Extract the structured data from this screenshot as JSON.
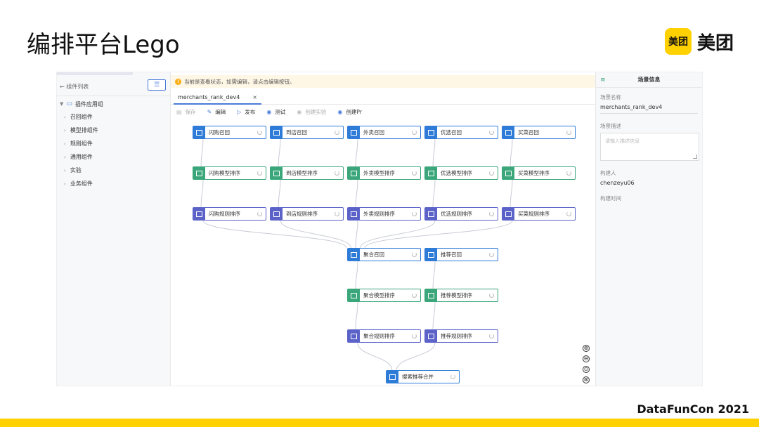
{
  "slide": {
    "title": "编排平台Lego",
    "logo_badge": "美团",
    "logo_text": "美团",
    "footer": "DataFunCon 2021",
    "accent_color": "#ffd100"
  },
  "left_panel": {
    "header": "← 组件列表",
    "filter_icon": "filter-icon",
    "tree_root": "插件应用组",
    "items": [
      "召回组件",
      "模型排组件",
      "规则组件",
      "通用组件",
      "实验",
      "业务组件"
    ]
  },
  "banner": {
    "text": "当前是查看状态，如需编辑，请点击编辑按钮。",
    "icon": "warning-icon"
  },
  "tab": {
    "label": "merchants_rank_dev4",
    "close": "×"
  },
  "toolbar": [
    {
      "label": "保存",
      "icon": "save-icon",
      "enabled": false
    },
    {
      "label": "编辑",
      "icon": "edit-icon",
      "enabled": true
    },
    {
      "label": "发布",
      "icon": "publish-icon",
      "enabled": true
    },
    {
      "label": "测试",
      "icon": "test-icon",
      "enabled": true
    },
    {
      "label": "创建实验",
      "icon": "experiment-icon",
      "enabled": false
    },
    {
      "label": "创建Pr",
      "icon": "pr-icon",
      "enabled": true
    }
  ],
  "graph": {
    "nodes": [
      {
        "id": "r1",
        "label": "闪购召回",
        "kind": "recall",
        "col": 0,
        "row": 0
      },
      {
        "id": "r2",
        "label": "到店召回",
        "kind": "recall",
        "col": 1,
        "row": 0
      },
      {
        "id": "r3",
        "label": "外卖召回",
        "kind": "recall",
        "col": 2,
        "row": 0
      },
      {
        "id": "r4",
        "label": "优选召回",
        "kind": "recall",
        "col": 3,
        "row": 0
      },
      {
        "id": "r5",
        "label": "买菜召回",
        "kind": "recall",
        "col": 4,
        "row": 0
      },
      {
        "id": "m1",
        "label": "闪购模型排序",
        "kind": "model",
        "col": 0,
        "row": 1
      },
      {
        "id": "m2",
        "label": "到店模型排序",
        "kind": "model",
        "col": 1,
        "row": 1
      },
      {
        "id": "m3",
        "label": "外卖模型排序",
        "kind": "model",
        "col": 2,
        "row": 1
      },
      {
        "id": "m4",
        "label": "优选模型排序",
        "kind": "model",
        "col": 3,
        "row": 1
      },
      {
        "id": "m5",
        "label": "买菜模型排序",
        "kind": "model",
        "col": 4,
        "row": 1
      },
      {
        "id": "u1",
        "label": "闪购规则排序",
        "kind": "rule",
        "col": 0,
        "row": 2
      },
      {
        "id": "u2",
        "label": "到店规则排序",
        "kind": "rule",
        "col": 1,
        "row": 2
      },
      {
        "id": "u3",
        "label": "外卖规则排序",
        "kind": "rule",
        "col": 2,
        "row": 2
      },
      {
        "id": "u4",
        "label": "优选规则排序",
        "kind": "rule",
        "col": 3,
        "row": 2
      },
      {
        "id": "u5",
        "label": "买菜规则排序",
        "kind": "rule",
        "col": 4,
        "row": 2
      },
      {
        "id": "a1",
        "label": "聚合召回",
        "kind": "recall",
        "col": 2,
        "row": 3
      },
      {
        "id": "a2",
        "label": "推荐召回",
        "kind": "recall",
        "col": 3,
        "row": 3
      },
      {
        "id": "b1",
        "label": "聚合模型排序",
        "kind": "model",
        "col": 2,
        "row": 4
      },
      {
        "id": "b2",
        "label": "推荐模型排序",
        "kind": "model",
        "col": 3,
        "row": 4
      },
      {
        "id": "c1",
        "label": "聚合规则排序",
        "kind": "rule",
        "col": 2,
        "row": 5
      },
      {
        "id": "c2",
        "label": "推荐规则排序",
        "kind": "rule",
        "col": 3,
        "row": 5
      },
      {
        "id": "f1",
        "label": "搜索推荐合并",
        "kind": "recall",
        "col": 2.5,
        "row": 6
      }
    ],
    "edges": [
      [
        "r1",
        "m1"
      ],
      [
        "r2",
        "m2"
      ],
      [
        "r3",
        "m3"
      ],
      [
        "r4",
        "m4"
      ],
      [
        "r5",
        "m5"
      ],
      [
        "m1",
        "u1"
      ],
      [
        "m2",
        "u2"
      ],
      [
        "m3",
        "u3"
      ],
      [
        "m4",
        "u4"
      ],
      [
        "m5",
        "u5"
      ],
      [
        "u1",
        "a1"
      ],
      [
        "u2",
        "a1"
      ],
      [
        "u3",
        "a1"
      ],
      [
        "u4",
        "a1"
      ],
      [
        "u5",
        "a1"
      ],
      [
        "a1",
        "b1"
      ],
      [
        "a2",
        "b2"
      ],
      [
        "b1",
        "c1"
      ],
      [
        "b2",
        "c2"
      ],
      [
        "c1",
        "f1"
      ],
      [
        "c2",
        "f1"
      ]
    ],
    "colors": {
      "recall": "#2f7bd8",
      "model": "#3aa67a",
      "rule": "#5b62c8"
    }
  },
  "zoom_controls": [
    "⊕",
    "⊖",
    "⊙",
    "⊗"
  ],
  "right_panel": {
    "title": "场景信息",
    "scene_name_label": "场景名称",
    "scene_name": "merchants_rank_dev4",
    "scene_desc_label": "场景描述",
    "scene_desc_placeholder": "请输入描述信息",
    "creator_label": "构建人",
    "creator": "chenzeyu06",
    "created_time_label": "构建时间"
  }
}
